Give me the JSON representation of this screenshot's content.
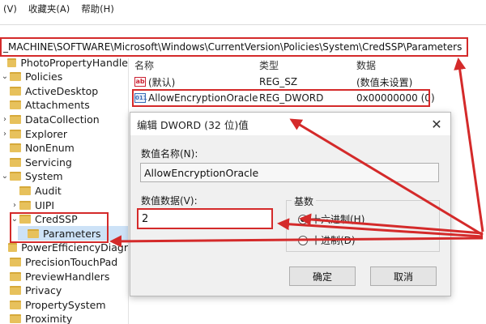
{
  "menu": [
    "(V)",
    "收藏夹(A)",
    "帮助(H)"
  ],
  "address": "_MACHINE\\SOFTWARE\\Microsoft\\Windows\\CurrentVersion\\Policies\\System\\CredSSP\\Parameters",
  "tree": [
    {
      "label": "PhotoPropertyHandle",
      "indent": 0,
      "chev": ""
    },
    {
      "label": "Policies",
      "indent": 0,
      "chev": "⌄"
    },
    {
      "label": "ActiveDesktop",
      "indent": 1,
      "chev": ""
    },
    {
      "label": "Attachments",
      "indent": 1,
      "chev": ""
    },
    {
      "label": "DataCollection",
      "indent": 1,
      "chev": "›"
    },
    {
      "label": "Explorer",
      "indent": 1,
      "chev": "›"
    },
    {
      "label": "NonEnum",
      "indent": 1,
      "chev": ""
    },
    {
      "label": "Servicing",
      "indent": 1,
      "chev": ""
    },
    {
      "label": "System",
      "indent": 1,
      "chev": "⌄"
    },
    {
      "label": "Audit",
      "indent": 2,
      "chev": ""
    },
    {
      "label": "UIPI",
      "indent": 2,
      "chev": "›"
    },
    {
      "label": "CredSSP",
      "indent": 2,
      "chev": "⌄"
    },
    {
      "label": "Parameters",
      "indent": 3,
      "chev": "",
      "selected": true
    },
    {
      "label": "PowerEfficiencyDiagr",
      "indent": 0,
      "chev": ""
    },
    {
      "label": "PrecisionTouchPad",
      "indent": 0,
      "chev": ""
    },
    {
      "label": "PreviewHandlers",
      "indent": 0,
      "chev": ""
    },
    {
      "label": "Privacy",
      "indent": 0,
      "chev": ""
    },
    {
      "label": "PropertySystem",
      "indent": 0,
      "chev": ""
    },
    {
      "label": "Proximity",
      "indent": 0,
      "chev": ""
    }
  ],
  "values": {
    "headers": {
      "name": "名称",
      "type": "类型",
      "data": "数据"
    },
    "rows": [
      {
        "icon": "ab",
        "name": "(默认)",
        "type": "REG_SZ",
        "data": "(数值未设置)"
      },
      {
        "icon": "dw",
        "name": "AllowEncryptionOracle",
        "type": "REG_DWORD",
        "data": "0x00000000 (0)"
      }
    ]
  },
  "dialog": {
    "title": "编辑 DWORD (32 位)值",
    "close": "✕",
    "name_label": "数值名称(N):",
    "name_value": "AllowEncryptionOracle",
    "data_label": "数值数据(V):",
    "data_value": "2",
    "base_label": "基数",
    "hex_label": "十六进制(H)",
    "dec_label": "十进制(D)",
    "ok": "确定",
    "cancel": "取消"
  },
  "icons": {
    "tree_icon": "folder-icon",
    "ab_text": "ab",
    "dw_text": "011"
  },
  "colors": {
    "highlight": "#d42a2a",
    "folder": "#e7c15c",
    "selection": "#cde2f7"
  }
}
